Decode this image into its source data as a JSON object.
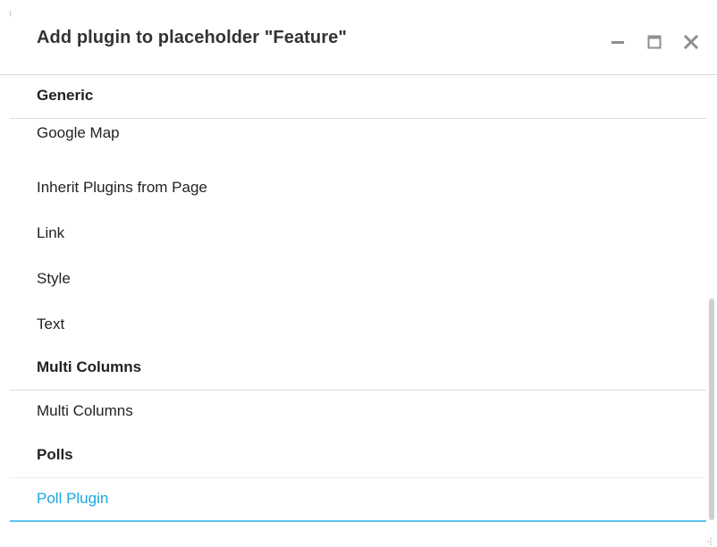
{
  "dialog": {
    "title": "Add plugin to placeholder \"Feature\"",
    "controls": {
      "minimize_icon": "minimize-icon",
      "maximize_icon": "maximize-icon",
      "close_icon": "close-icon"
    }
  },
  "plugin_groups": [
    {
      "name": "Generic",
      "plugins": [
        "Google Map",
        "Inherit Plugins from Page",
        "Link",
        "Style",
        "Text"
      ]
    },
    {
      "name": "Multi Columns",
      "plugins": [
        "Multi Columns"
      ]
    },
    {
      "name": "Polls",
      "plugins": [
        "Poll Plugin"
      ]
    }
  ],
  "active_plugin": "Poll Plugin",
  "colors": {
    "accent": "#1aa7e0",
    "divider": "#dcdcdc",
    "text": "#222222"
  }
}
